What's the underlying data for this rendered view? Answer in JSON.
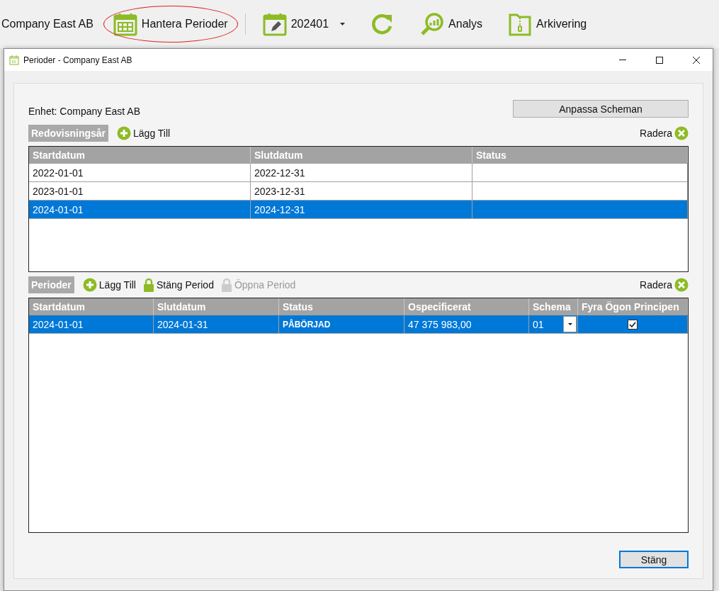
{
  "toolbar": {
    "company": "Company East AB",
    "items": [
      {
        "kind": "calendar-grid",
        "label": "Hantera Perioder",
        "highlighted": true
      },
      {
        "kind": "separator"
      },
      {
        "kind": "calendar-edit",
        "label": "202401",
        "dropdown": true
      },
      {
        "kind": "refresh"
      },
      {
        "kind": "analysis",
        "label": "Analys"
      },
      {
        "kind": "archive",
        "label": "Arkivering"
      }
    ]
  },
  "dialog": {
    "title": "Perioder - Company East AB",
    "entity": "Enhet: Company East AB",
    "customize_button": "Anpassa Scheman",
    "years": {
      "heading": "Redovisningsår",
      "add": "Lägg Till",
      "delete": "Radera",
      "columns": [
        "Startdatum",
        "Slutdatum",
        "Status"
      ],
      "rows": [
        {
          "cells": [
            "2022-01-01",
            "2022-12-31",
            ""
          ],
          "selected": false
        },
        {
          "cells": [
            "2023-01-01",
            "2023-12-31",
            ""
          ],
          "selected": false
        },
        {
          "cells": [
            "2024-01-01",
            "2024-12-31",
            ""
          ],
          "selected": true
        }
      ]
    },
    "periods": {
      "heading": "Perioder",
      "actions": [
        {
          "label": "Lägg Till",
          "kind": "add",
          "disabled": false
        },
        {
          "label": "Stäng Period",
          "kind": "lock",
          "disabled": false
        },
        {
          "label": "Öppna Period",
          "kind": "lock",
          "disabled": true
        }
      ],
      "delete": "Radera",
      "columns": [
        "Startdatum",
        "Slutdatum",
        "Status",
        "Ospecificerat",
        "Schema",
        "Fyra Ögon Principen"
      ],
      "rows": [
        {
          "start": "2024-01-01",
          "end": "2024-01-31",
          "status": "PÅBÖRJAD",
          "unspecified": "47 375 983,00",
          "schema": "01",
          "four_eyes": true,
          "selected": true
        }
      ]
    },
    "close_button": "Stäng"
  }
}
